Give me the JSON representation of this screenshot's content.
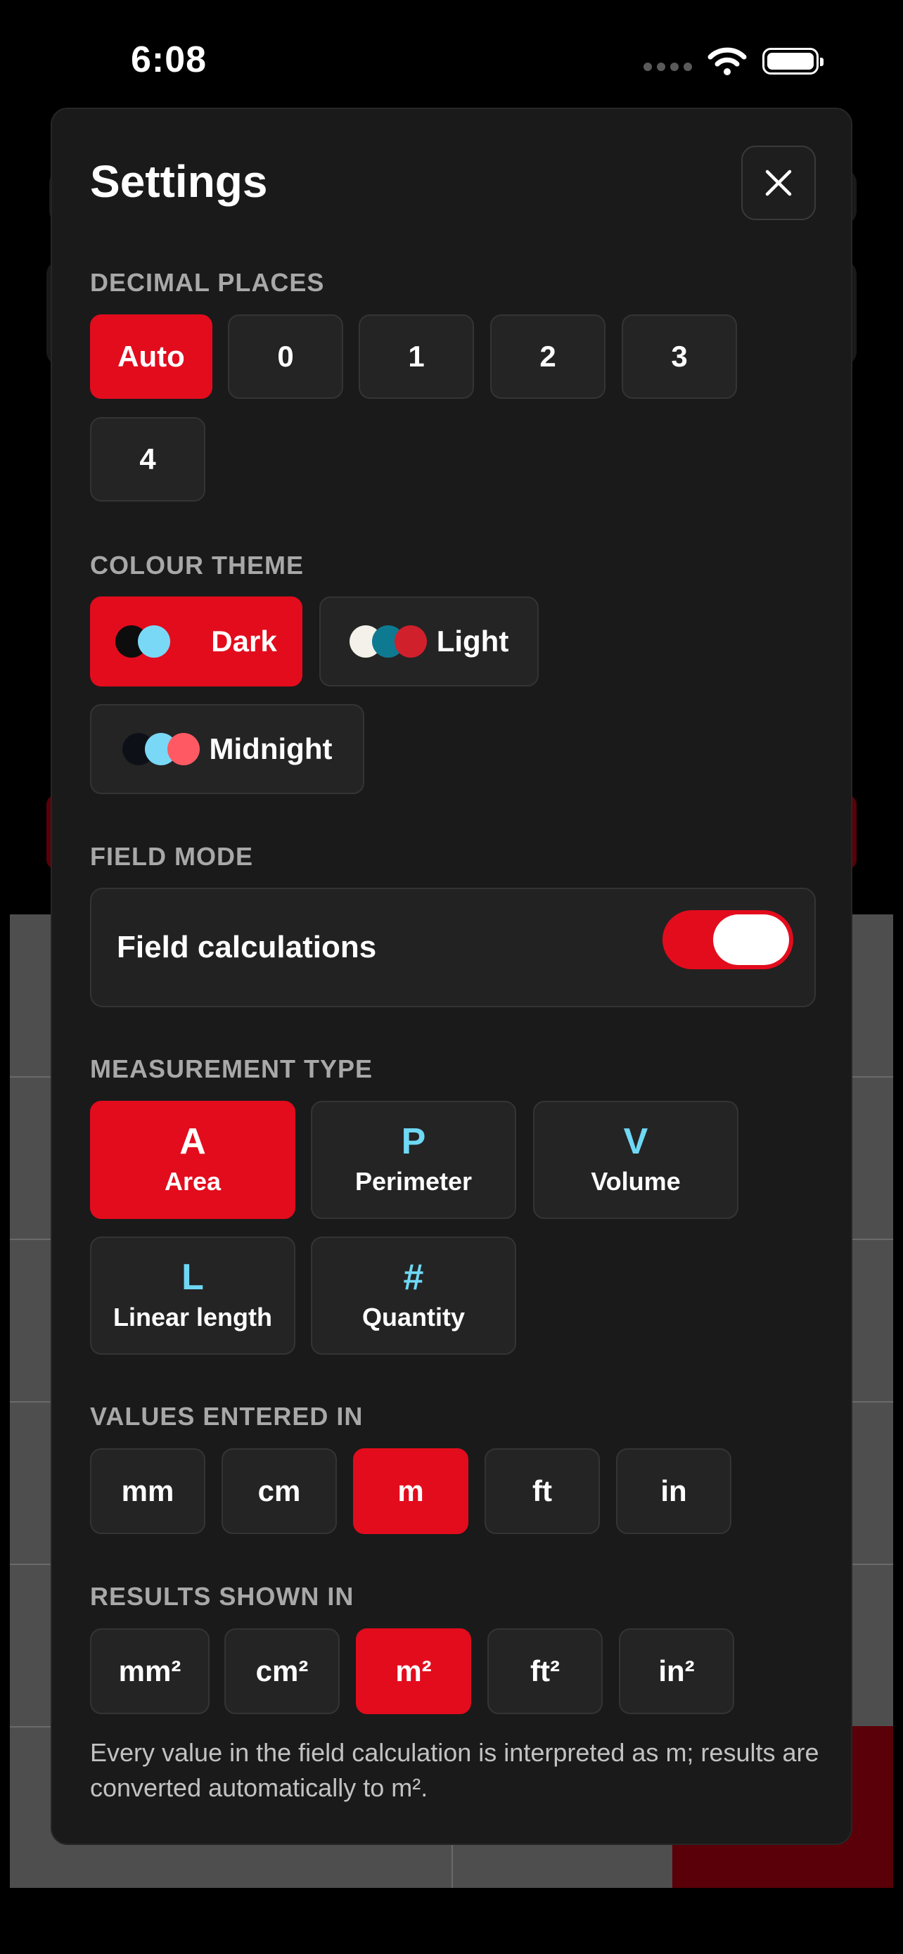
{
  "status_bar": {
    "time": "6:08",
    "icons": [
      "cellular-dots-icon",
      "wifi-icon",
      "battery-icon"
    ]
  },
  "settings": {
    "title": "Settings",
    "close_icon": "close-icon",
    "decimal_places": {
      "label": "DECIMAL PLACES",
      "options": [
        "Auto",
        "0",
        "1",
        "2",
        "3",
        "4"
      ],
      "selected": "Auto"
    },
    "colour_theme": {
      "label": "COLOUR THEME",
      "options": [
        {
          "label": "Dark",
          "swatches": [
            "#0d0d0d",
            "#7ad8f7"
          ]
        },
        {
          "label": "Light",
          "swatches": [
            "#f3f1e9",
            "#0e7a92",
            "#d0202c"
          ]
        },
        {
          "label": "Midnight",
          "swatches": [
            "#0d1117",
            "#7ad8f7",
            "#ff5a64"
          ]
        }
      ],
      "selected": "Dark"
    },
    "field_mode": {
      "label": "FIELD MODE",
      "toggle_label": "Field calculations",
      "enabled": true
    },
    "measurement_type": {
      "label": "MEASUREMENT TYPE",
      "options": [
        {
          "letter": "A",
          "label": "Area"
        },
        {
          "letter": "P",
          "label": "Perimeter"
        },
        {
          "letter": "V",
          "label": "Volume"
        },
        {
          "letter": "L",
          "label": "Linear length"
        },
        {
          "letter": "#",
          "label": "Quantity"
        }
      ],
      "selected": "Area"
    },
    "values_entered_in": {
      "label": "VALUES ENTERED IN",
      "options": [
        "mm",
        "cm",
        "m",
        "ft",
        "in"
      ],
      "selected": "m"
    },
    "results_shown_in": {
      "label": "RESULTS SHOWN IN",
      "options": [
        "mm²",
        "cm²",
        "m²",
        "ft²",
        "in²"
      ],
      "selected": "m²"
    },
    "footnote": "Every value in the field calculation is interpreted as m; results are converted automatically to m²."
  },
  "colors": {
    "accent": "#e20c1d",
    "letter_accent": "#6fd8f5",
    "sheet": "#1a1a1a",
    "chip": "#242424"
  }
}
